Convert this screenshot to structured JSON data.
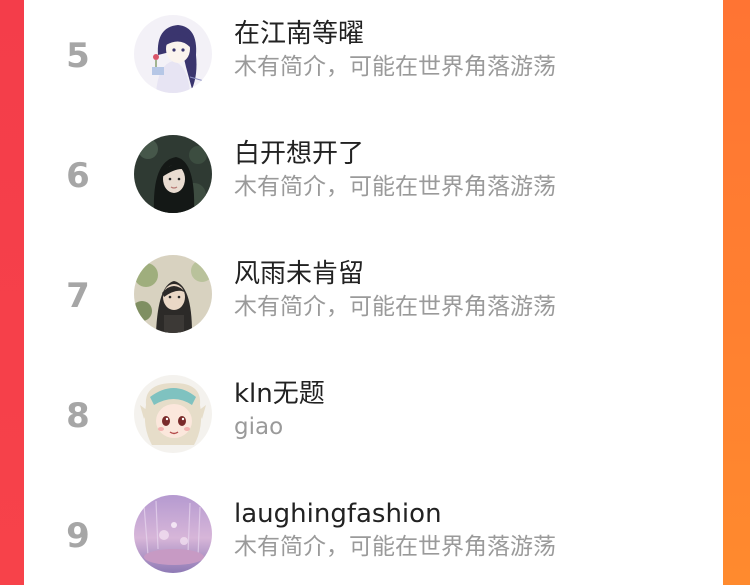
{
  "ranking_list": {
    "items": [
      {
        "rank": "5",
        "name": "在江南等曜",
        "bio": "木有简介，可能在世界角落游荡",
        "avatar_icon": "anime-girl-avatar-icon"
      },
      {
        "rank": "6",
        "name": "白开想开了",
        "bio": "木有简介，可能在世界角落游荡",
        "avatar_icon": "dark-portrait-avatar-icon"
      },
      {
        "rank": "7",
        "name": "风雨未肯留",
        "bio": "木有简介，可能在世界角落游荡",
        "avatar_icon": "outdoor-portrait-avatar-icon"
      },
      {
        "rank": "8",
        "name": "kln无题",
        "bio": "giao",
        "avatar_icon": "cartoon-character-avatar-icon"
      },
      {
        "rank": "9",
        "name": "laughingfashion",
        "bio": "木有简介，可能在世界角落游荡",
        "avatar_icon": "purple-scene-avatar-icon"
      }
    ]
  },
  "colors": {
    "rank": "#a6a6a6",
    "name": "#222222",
    "bio": "#9a9a9a",
    "left_edge": "#f43d4a",
    "right_edge": "#ff7a30"
  }
}
